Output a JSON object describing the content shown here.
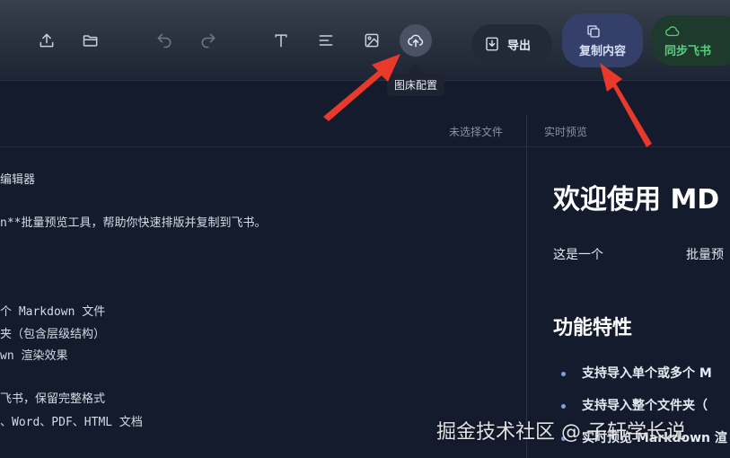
{
  "toolbar": {
    "icons": [
      {
        "name": "upload-icon"
      },
      {
        "name": "folder-icon"
      },
      {
        "name": "undo-icon"
      },
      {
        "name": "redo-icon"
      },
      {
        "name": "text-icon"
      },
      {
        "name": "align-icon"
      },
      {
        "name": "image-icon"
      },
      {
        "name": "cloud-upload-icon"
      }
    ],
    "tooltip": "图床配置",
    "export_label": "导出",
    "copy_label": "复制内容",
    "sync_label": "同步飞书",
    "colors": {
      "copy_bg": "#34406a",
      "sync_bg": "#1d3a2c",
      "sync_text": "#56d07e",
      "arrow": "#e8392b"
    }
  },
  "subbar": {
    "file_status": "未选择文件",
    "preview_label": "实时预览"
  },
  "editor": {
    "lines": [
      "编辑器",
      "n**批量预览工具，帮助你快速排版并复制到飞书。",
      "个 Markdown 文件",
      "夹（包含层级结构）",
      "wn 渲染效果",
      "飞书，保留完整格式",
      "、Word、PDF、HTML 文档"
    ]
  },
  "preview": {
    "h1": "欢迎使用 MD",
    "p_left": "这是一个",
    "p_right": "批量预",
    "h2": "功能特性",
    "items": [
      "支持导入单个或多个 M",
      "支持导入整个文件夹（",
      "实时预览 Markdown 渲"
    ]
  },
  "watermark": "掘金技术社区 @ 子轩学长说"
}
